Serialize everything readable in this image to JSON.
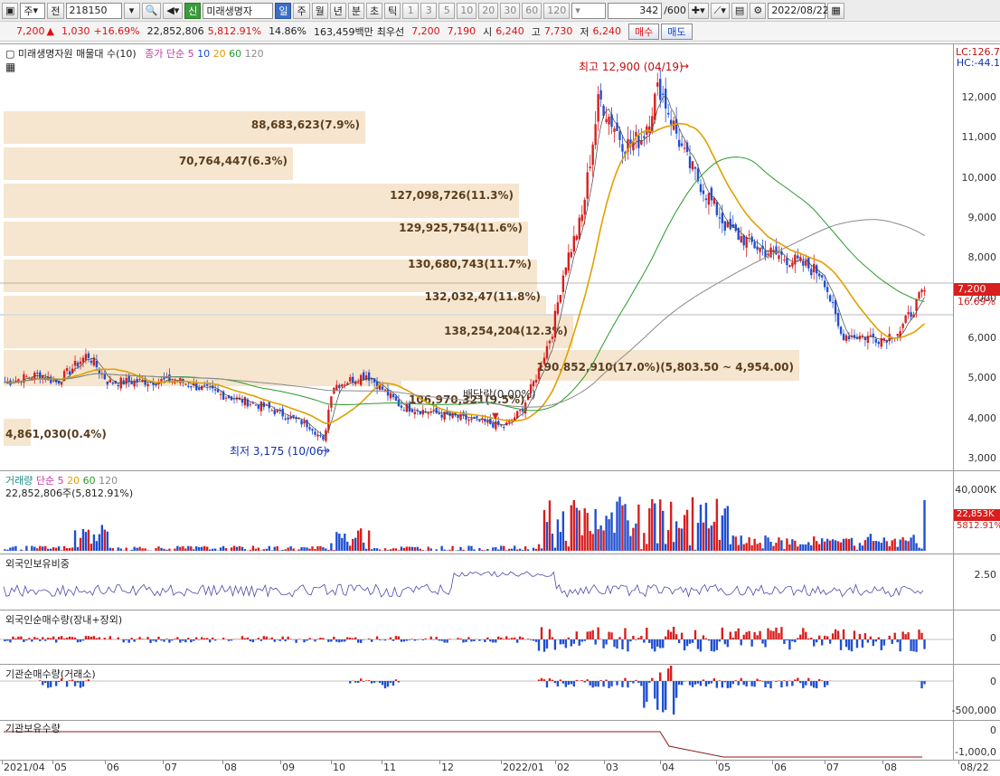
{
  "toolbar": {
    "market_sel": "주",
    "jeon": "전",
    "code": "218150",
    "new_badge": "신",
    "stock_name": "미래생명자",
    "periods": [
      "일",
      "주",
      "월",
      "년",
      "분",
      "초",
      "틱"
    ],
    "active_period": "일",
    "numbers": [
      "1",
      "3",
      "5",
      "10",
      "20",
      "30",
      "60",
      "120"
    ],
    "count": "342",
    "count_total": "/600",
    "date": "2022/08/22"
  },
  "quote": {
    "price": "7,200",
    "change": "1,030",
    "change_pct": "+16.69%",
    "volume": "22,852,806",
    "vol_ratio": "5,812.91%",
    "turnover": "14.86%",
    "amount": "163,459백만",
    "best_label": "최우선",
    "ask": "7,200",
    "bid": "7,190",
    "open_label": "시",
    "open": "6,240",
    "high_label": "고",
    "high": "7,730",
    "low_label": "저",
    "low": "6,240",
    "buy": "매수",
    "sell": "매도"
  },
  "price_panel": {
    "legend_title": "미래생명자원 매물대 수(10)",
    "ma_legend": "종가 단순",
    "ma_values": [
      "5",
      "10",
      "20",
      "60",
      "120"
    ],
    "lc_label": "LC:126.7",
    "hc_label": "HC:-44.1",
    "last_price_tag": "7,200",
    "last_pct_tag": "16.69%",
    "high_ann": "최고 12,900 (04/19)",
    "low_ann": "최저 3,175 (10/06)",
    "dividend_ann": "배당락(0.00%)",
    "axis": [
      "12,000",
      "11,000",
      "10,000",
      "9,000",
      "8,000",
      "7,000",
      "6,000",
      "5,000",
      "4,000",
      "3,000"
    ],
    "volume_profile": [
      {
        "label": "88,683,623(7.9%)",
        "frac": 0.4
      },
      {
        "label": "70,764,447(6.3%)",
        "frac": 0.32
      },
      {
        "label": "127,098,726(11.3%)",
        "frac": 0.57
      },
      {
        "label": "129,925,754(11.6%)",
        "frac": 0.58
      },
      {
        "label": "130,680,743(11.7%)",
        "frac": 0.59
      },
      {
        "label": "132,032,47(11.8%)",
        "frac": 0.6
      },
      {
        "label": "138,254,204(12.3%)",
        "frac": 0.63
      },
      {
        "label": "190,852,910(17.0%)(5,803.50 ~ 4,954.00)",
        "frac": 0.88
      },
      {
        "label": "106,970,321(9.5%)",
        "frac": 0.44
      },
      {
        "label": "4,861,030(0.4%)",
        "frac": 0.02
      }
    ]
  },
  "volume_panel": {
    "title": "거래량",
    "ma_legend": "단순",
    "ma_values": [
      "5",
      "20",
      "60",
      "120"
    ],
    "sub": "22,852,806주(5,812.91%)",
    "axis_top": "40,000K",
    "tag_vol": "22,853K",
    "tag_pct": "5812.91%"
  },
  "foreign_own": {
    "title": "외국인보유비중",
    "axis": "2.50"
  },
  "foreign_net": {
    "title": "외국인순매수량(장내+장외)",
    "axis": "0"
  },
  "inst_net": {
    "title": "기관순매수량(거래소)",
    "axis": [
      "0",
      "-500,000"
    ]
  },
  "inst_own": {
    "title": "기관보유수량",
    "axis": [
      "0",
      "-1,000,0"
    ]
  },
  "x_axis": [
    "2021/04",
    "05",
    "06",
    "07",
    "08",
    "09",
    "10",
    "11",
    "12",
    "2022/01",
    "02",
    "03",
    "04",
    "05",
    "06",
    "07",
    "08",
    "08/22"
  ],
  "colors": {
    "up": "#d81e1e",
    "down": "#1f4fd1",
    "ma5": "#444444",
    "ma20": "#e0a000",
    "ma60": "#2a9a2a",
    "ma120": "#8a8a8a"
  }
}
